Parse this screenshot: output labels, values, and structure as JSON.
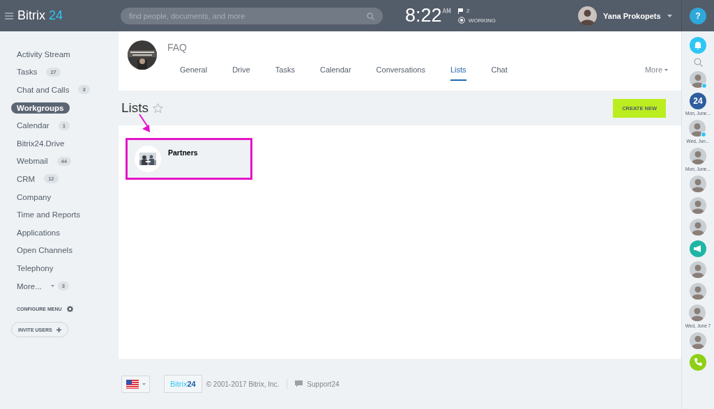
{
  "header": {
    "brand": "Bitrix",
    "brand_accent": "24",
    "search": {
      "placeholder": "find people, documents, and more"
    },
    "clock": {
      "time": "8:22",
      "period": "AM"
    },
    "flags": "2",
    "status": "WORKING",
    "user": "Yana Prokopets",
    "help": "?"
  },
  "sidebar": {
    "items": [
      {
        "label": "Activity Stream",
        "selected": false
      },
      {
        "label": "Tasks",
        "count": "27",
        "selected": false
      },
      {
        "label": "Chat and Calls",
        "count": "3",
        "selected": false
      },
      {
        "label": "Workgroups",
        "selected": true
      },
      {
        "label": "Calendar",
        "count": "1",
        "selected": false
      },
      {
        "label": "Bitrix24.Drive",
        "selected": false
      },
      {
        "label": "Webmail",
        "count": "44",
        "selected": false
      },
      {
        "label": "CRM",
        "count": "12",
        "selected": false
      },
      {
        "label": "Company",
        "selected": false
      },
      {
        "label": "Time and Reports",
        "selected": false
      },
      {
        "label": "Applications",
        "selected": false
      },
      {
        "label": "Open Channels",
        "selected": false
      },
      {
        "label": "Telephony",
        "selected": false
      },
      {
        "label": "More...",
        "count": "3",
        "selected": false,
        "dropdown": true
      }
    ],
    "configure": "CONFIGURE MENU",
    "invite": "INVITE USERS"
  },
  "group": {
    "name": "FAQ",
    "tabs": [
      {
        "label": "General",
        "selected": false
      },
      {
        "label": "Drive",
        "selected": false
      },
      {
        "label": "Tasks",
        "selected": false
      },
      {
        "label": "Calendar",
        "selected": false
      },
      {
        "label": "Conversations",
        "selected": false
      },
      {
        "label": "Lists",
        "selected": true
      },
      {
        "label": "Chat",
        "selected": false
      }
    ],
    "more": "More"
  },
  "page": {
    "title": "Lists",
    "starred": false,
    "create_button": "CREATE NEW"
  },
  "lists": [
    {
      "name": "Partners",
      "highlighted": true
    }
  ],
  "footer": {
    "logo": "Bitrix",
    "logo_accent": "24",
    "copyright": "© 2001-2017 Bitrix, Inc.",
    "support": "Support24"
  },
  "right_bar": [
    {
      "kind": "bell"
    },
    {
      "kind": "search"
    },
    {
      "kind": "avatar",
      "online": true
    },
    {
      "kind": "logo",
      "text": "24",
      "caption": "Mon, June..."
    },
    {
      "kind": "avatar",
      "online": true,
      "caption": "Wed, Jun..."
    },
    {
      "kind": "avatar",
      "online": false,
      "caption": "Mon, June..."
    },
    {
      "kind": "avatar",
      "online": false
    },
    {
      "kind": "avatar",
      "online": false
    },
    {
      "kind": "avatar",
      "online": false
    },
    {
      "kind": "megaphone"
    },
    {
      "kind": "avatar",
      "online": false
    },
    {
      "kind": "avatar",
      "online": false
    },
    {
      "kind": "avatar",
      "online": false,
      "caption": "Wed, June 7"
    },
    {
      "kind": "avatar",
      "online": false
    },
    {
      "kind": "phone"
    }
  ]
}
